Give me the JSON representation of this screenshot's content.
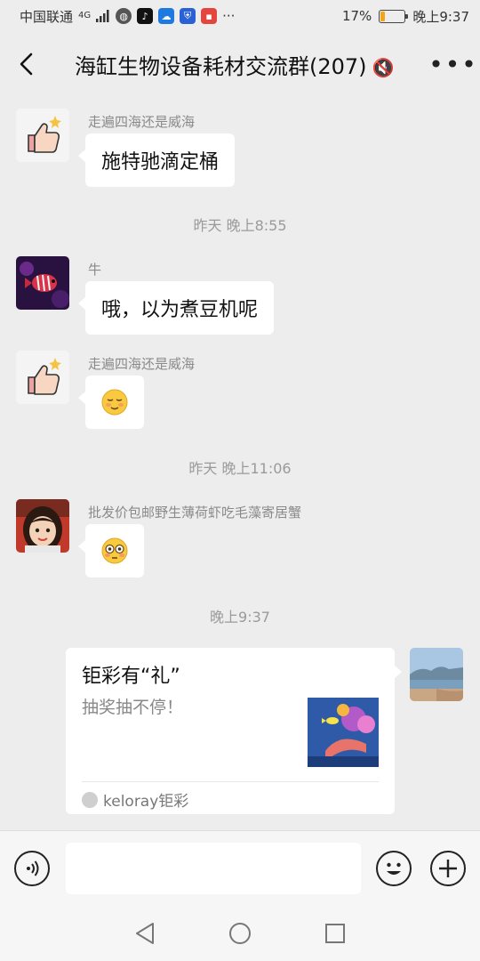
{
  "status_bar": {
    "carrier": "中国联通",
    "network": "4G",
    "battery_percent": "17%",
    "battery_level": 0.17,
    "time": "晚上9:37",
    "notification_icons": [
      "browser-icon",
      "tiktok-icon",
      "cloud-icon",
      "shield-icon",
      "app-icon"
    ],
    "overflow": "···"
  },
  "header": {
    "title": "海缸生物设备耗材交流群(207)",
    "title_overflow": "🔇"
  },
  "messages": [
    {
      "sender": "走遍四海还是威海",
      "text": "施特驰滴定桶",
      "avatar": "thumbs-up-avatar"
    },
    {
      "time": "昨天 晚上8:55"
    },
    {
      "sender": "牛",
      "text": "哦，以为煮豆机呢",
      "avatar": "fish-avatar"
    },
    {
      "sender": "走遍四海还是威海",
      "emoji": "relieved-face",
      "avatar": "thumbs-up-avatar"
    },
    {
      "time": "昨天 晚上11:06"
    },
    {
      "sender": "批发价包邮野生薄荷虾吃毛藻寄居蟹",
      "emoji": "flushed-face",
      "avatar": "girl-avatar"
    },
    {
      "time": "晚上9:37"
    }
  ],
  "card": {
    "title": "钜彩有“礼”",
    "description": "抽奖抽不停！",
    "source": "keloray钜彩"
  },
  "input": {
    "placeholder": ""
  }
}
